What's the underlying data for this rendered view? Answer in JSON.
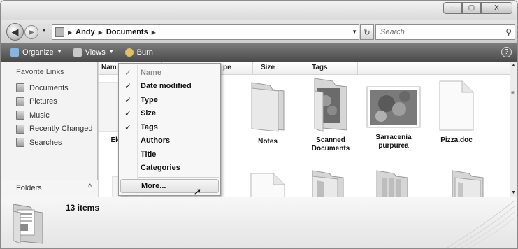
{
  "window": {
    "min_label": "–",
    "max_label": "▢",
    "close_label": "X"
  },
  "address": {
    "crumbs": [
      "Andy",
      "Documents"
    ],
    "search_placeholder": "Search"
  },
  "toolbar": {
    "organize": "Organize",
    "views": "Views",
    "burn": "Burn",
    "help": "?"
  },
  "navpane": {
    "title": "Favorite Links",
    "items": [
      "Documents",
      "Pictures",
      "Music",
      "Recently Changed",
      "Searches"
    ],
    "folders_label": "Folders"
  },
  "columns": [
    "Nam",
    "pe",
    "Size",
    "Tags"
  ],
  "items": [
    {
      "label": "Ele",
      "icon": "folder-icon"
    },
    {
      "label": "Notes",
      "icon": "folder-icon"
    },
    {
      "label": "Scanned Documents",
      "icon": "folder-photo-icon"
    },
    {
      "label": "Sarracenia purpurea",
      "icon": "photo-thumbnail"
    },
    {
      "label": "Pizza.doc",
      "icon": "document-icon"
    }
  ],
  "menu": {
    "items": [
      {
        "label": "Name",
        "checked": true,
        "disabled": true
      },
      {
        "label": "Date modified",
        "checked": true,
        "disabled": false
      },
      {
        "label": "Type",
        "checked": true,
        "disabled": false
      },
      {
        "label": "Size",
        "checked": true,
        "disabled": false
      },
      {
        "label": "Tags",
        "checked": true,
        "disabled": false
      },
      {
        "label": "Authors",
        "checked": false,
        "disabled": false
      },
      {
        "label": "Title",
        "checked": false,
        "disabled": false
      },
      {
        "label": "Categories",
        "checked": false,
        "disabled": false
      }
    ],
    "more_label": "More..."
  },
  "details": {
    "count_label": "13 items"
  },
  "colors": {
    "toolbar_bg": "#5a5a5a",
    "content_bg": "#ffffff",
    "menu_bg": "#f7f7f7"
  }
}
